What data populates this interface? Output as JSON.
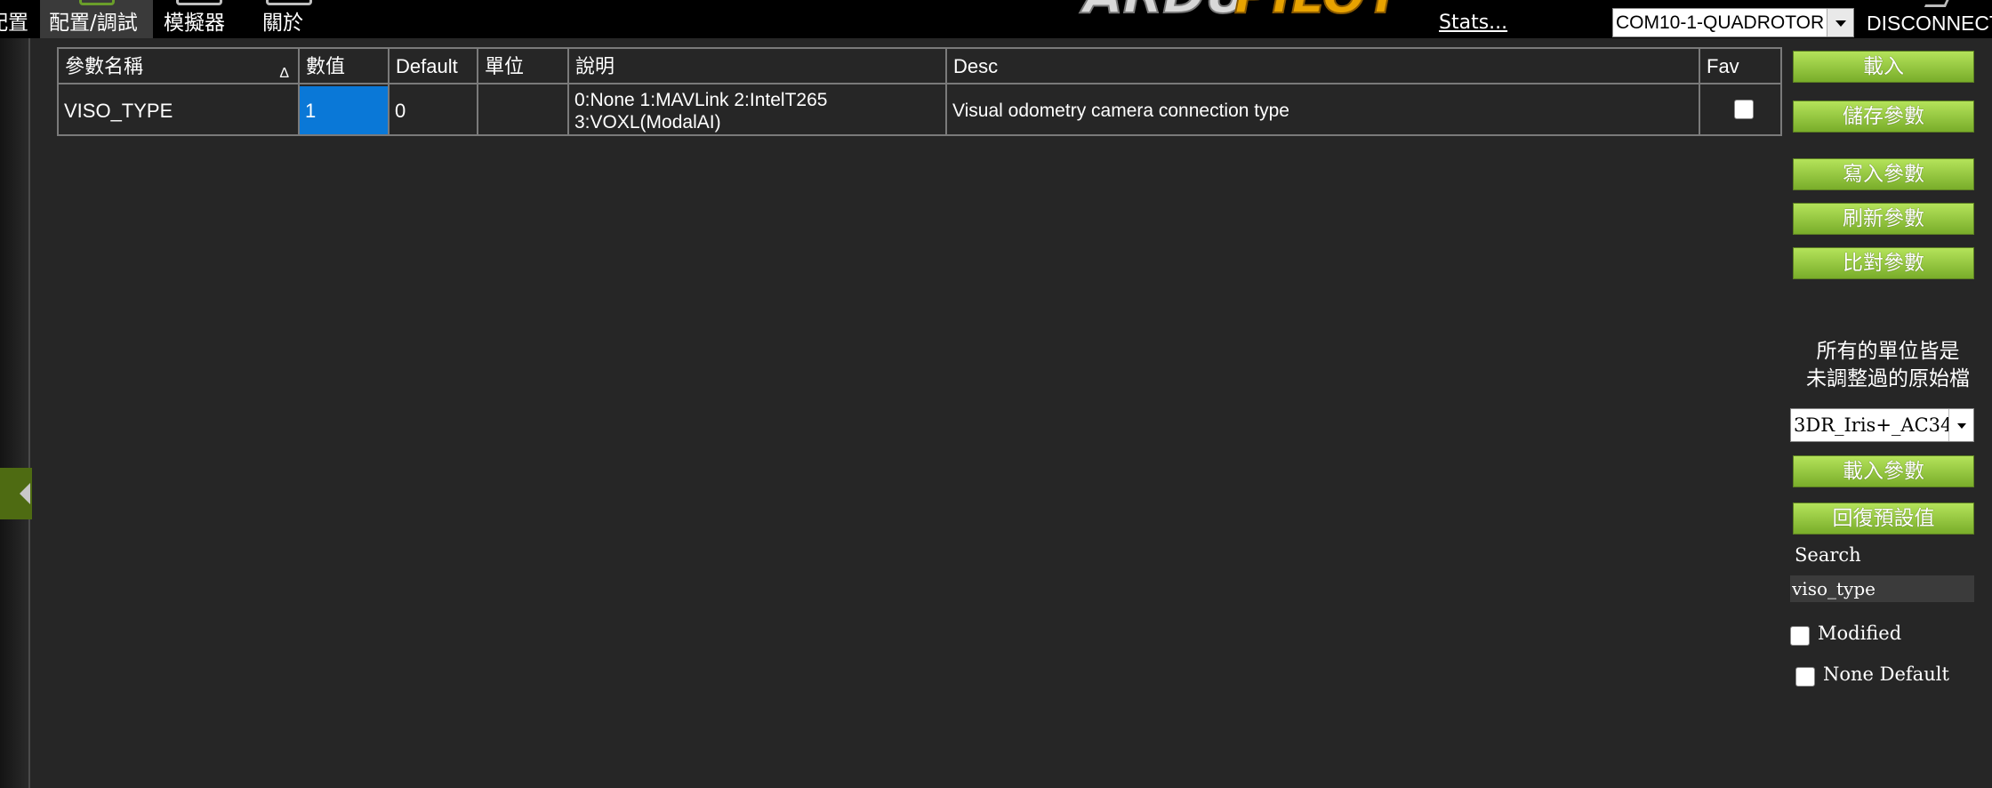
{
  "menu": {
    "config_partial": "配置",
    "config_tuning": "配置/調試",
    "simulation": "模擬器",
    "about": "關於"
  },
  "header": {
    "stats_link": "Stats...",
    "port_value": "COM10-1-QUADROTOR",
    "disconnect_label": "DISCONNECT"
  },
  "grid": {
    "columns": [
      "參數名稱",
      "數值",
      "Default",
      "單位",
      "說明",
      "Desc",
      "Fav"
    ],
    "sort_glyph": "Δ",
    "rows": [
      {
        "name": "VISO_TYPE",
        "value": "1",
        "default": "0",
        "units": "",
        "options": "0:None 1:MAVLink 2:IntelT265 3:VOXL(ModalAI)",
        "desc": "Visual odometry camera connection type",
        "fav": false
      }
    ]
  },
  "panel": {
    "load_button": "載入",
    "save_button": "儲存參數",
    "write_button": "寫入參數",
    "refresh_button": "刷新參數",
    "compare_button": "比對參數",
    "units_note_line1": "所有的單位皆是",
    "units_note_line2": "未調整過的原始檔",
    "param_file_value": "3DR_Iris+_AC34",
    "load_params_button": "載入參數",
    "reset_defaults_button": "回復預設值",
    "search_label": "Search",
    "search_value": "viso_type",
    "modified_label": "Modified",
    "modified_checked": false,
    "none_default_label": "None Default",
    "none_default_checked": false
  },
  "colors": {
    "accent_green": "#8cc63f",
    "selection_blue": "#0a78d7",
    "background": "#262626"
  }
}
